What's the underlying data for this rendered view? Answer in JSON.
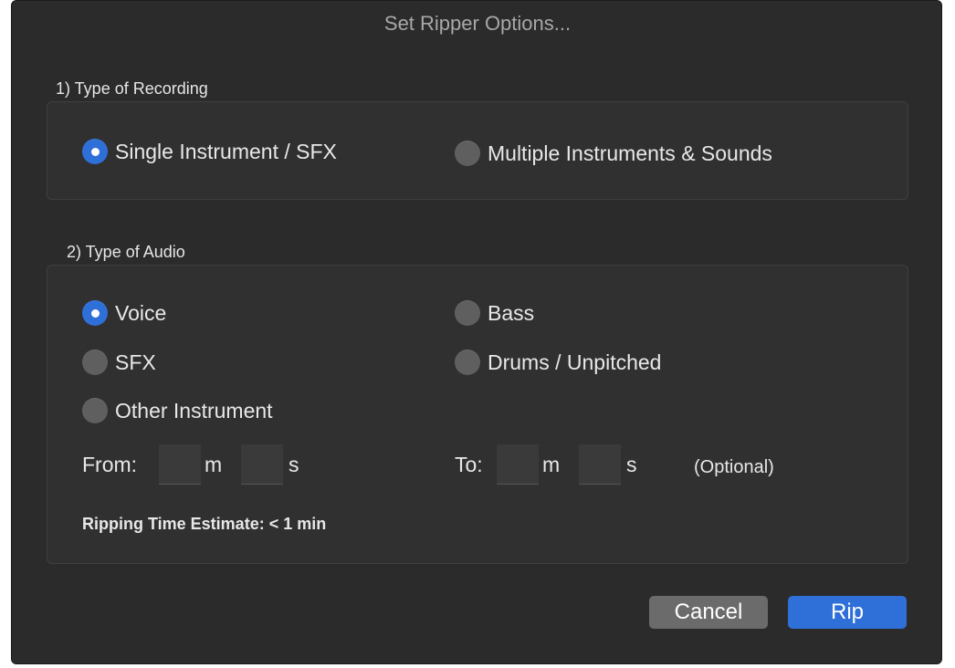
{
  "dialog": {
    "title": "Set Ripper Options..."
  },
  "recording": {
    "label": "1) Type of Recording",
    "options": [
      {
        "label": "Single Instrument / SFX",
        "selected": true
      },
      {
        "label": "Multiple Instruments & Sounds",
        "selected": false
      }
    ]
  },
  "audio": {
    "label": "2) Type of Audio",
    "options": [
      {
        "label": "Voice",
        "selected": true
      },
      {
        "label": "Bass",
        "selected": false
      },
      {
        "label": "SFX",
        "selected": false
      },
      {
        "label": "Drums / Unpitched",
        "selected": false
      },
      {
        "label": "Other Instrument",
        "selected": false
      }
    ],
    "from_label": "From:",
    "to_label": "To:",
    "minutes_unit": "m",
    "seconds_unit": "s",
    "from_minutes": "",
    "from_seconds": "",
    "to_minutes": "",
    "to_seconds": "",
    "optional_label": "(Optional)",
    "estimate": "Ripping Time Estimate: < 1 min"
  },
  "buttons": {
    "cancel": "Cancel",
    "rip": "Rip"
  },
  "colors": {
    "accent": "#2f6fd8",
    "background": "#2b2b2b"
  }
}
